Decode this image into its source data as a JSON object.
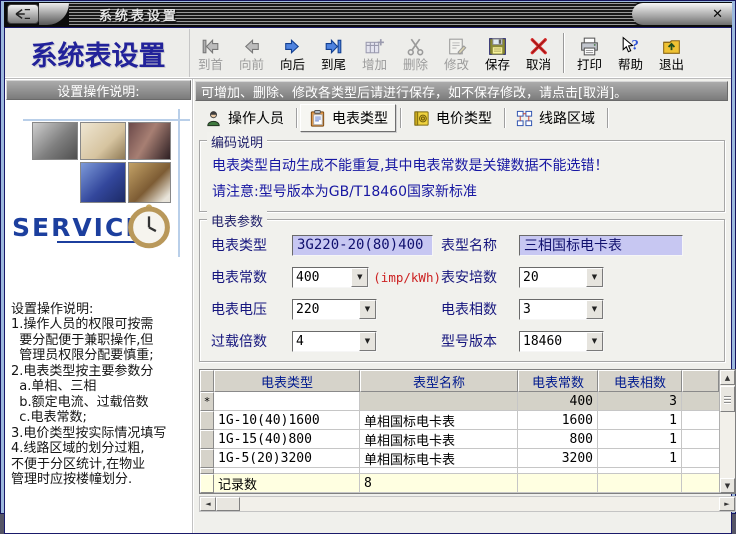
{
  "window": {
    "title": "系统表设置",
    "close": "✕"
  },
  "header": {
    "app_title": "系统表设置"
  },
  "icons_glyphs": {
    "up_arrow": "▲",
    "down_arrow": "▼",
    "left_arrow": "◄",
    "right_arrow": "►",
    "combo_arrow": "▼"
  },
  "colors": {
    "accent_navy": "#16167e",
    "title_navy": "#22229a",
    "field_lavender": "#c7c7f2",
    "alert_red": "#cc2222",
    "footer_yellow": "#ffffe1",
    "current_row_gray": "#d4d2c8"
  },
  "toolbar": {
    "nav_buttons": [
      {
        "label": "到首",
        "icon": "first-icon",
        "enabled": false
      },
      {
        "label": "向前",
        "icon": "prev-icon",
        "enabled": false
      },
      {
        "label": "向后",
        "icon": "next-icon",
        "enabled": true
      },
      {
        "label": "到尾",
        "icon": "last-icon",
        "enabled": true
      },
      {
        "label": "增加",
        "icon": "add-icon",
        "enabled": false
      },
      {
        "label": "删除",
        "icon": "delete-icon",
        "enabled": false
      },
      {
        "label": "修改",
        "icon": "modify-icon",
        "enabled": false
      },
      {
        "label": "保存",
        "icon": "save-icon",
        "enabled": true
      },
      {
        "label": "取消",
        "icon": "cancel-icon",
        "enabled": true
      }
    ],
    "app_buttons": [
      {
        "label": "打印",
        "icon": "print-icon",
        "enabled": true
      },
      {
        "label": "帮助",
        "icon": "help-icon",
        "enabled": true
      },
      {
        "label": "退出",
        "icon": "exit-icon",
        "enabled": true
      }
    ]
  },
  "sidebar": {
    "header": "设置操作说明:",
    "service": "SERVICE",
    "instructions": [
      "设置操作说明:",
      "1.操作人员的权限可按需",
      "  要分配便于兼职操作,但",
      "  管理员权限分配要慎重;",
      "2.电表类型按主要参数分",
      "  a.单相、三相",
      "  b.额定电流、过载倍数",
      "  c.电表常数;",
      "3.电价类型按实际情况填写",
      "4.线路区域的划分过粗,",
      "不便于分区统计,在物业",
      "管理时应按楼幢划分."
    ]
  },
  "main": {
    "notice": "可增加、删除、修改各类型后请进行保存，如不保存修改，请点击[取消]。",
    "tabs": [
      {
        "label": "操作人员",
        "icon": "operator-icon",
        "selected": false
      },
      {
        "label": "电表类型",
        "icon": "meter-type-icon",
        "selected": true
      },
      {
        "label": "电价类型",
        "icon": "price-type-icon",
        "selected": false
      },
      {
        "label": "线路区域",
        "icon": "line-area-icon",
        "selected": false
      }
    ],
    "coding": {
      "title": "编码说明",
      "line1": "电表类型自动生成不能重复,其中电表常数是关键数据不能选错！",
      "line2": "请注意:型号版本为GB/T18460国家新标准"
    },
    "params": {
      "title": "电表参数",
      "meter_type": {
        "label": "电表类型",
        "value": "3G220-20(80)400"
      },
      "model_name": {
        "label": "表型名称",
        "value": "三相国标电卡表"
      },
      "constant": {
        "label": "电表常数",
        "value": "400",
        "unit": "(imp/kWh)"
      },
      "ampere": {
        "label": "表安培数",
        "value": "20"
      },
      "voltage": {
        "label": "电表电压",
        "value": "220"
      },
      "phases": {
        "label": "电表相数",
        "value": "3"
      },
      "overload": {
        "label": "过载倍数",
        "value": "4"
      },
      "version": {
        "label": "型号版本",
        "value": "18460"
      }
    },
    "grid": {
      "headers": [
        "电表类型",
        "表型名称",
        "电表常数",
        "电表相数"
      ],
      "rows": [
        {
          "marker": "*",
          "type": "",
          "name": "",
          "constant": "400",
          "phases": "3",
          "current": true
        },
        {
          "marker": "",
          "type": "1G-10(40)1600",
          "name": "单相国标电卡表",
          "constant": "1600",
          "phases": "1",
          "current": false
        },
        {
          "marker": "",
          "type": "1G-15(40)800",
          "name": "单相国标电卡表",
          "constant": "800",
          "phases": "1",
          "current": false
        },
        {
          "marker": "",
          "type": "1G-5(20)3200",
          "name": "单相国标电卡表",
          "constant": "3200",
          "phases": "1",
          "current": false
        }
      ],
      "footer": {
        "label": "记录数",
        "value": "8"
      }
    }
  }
}
